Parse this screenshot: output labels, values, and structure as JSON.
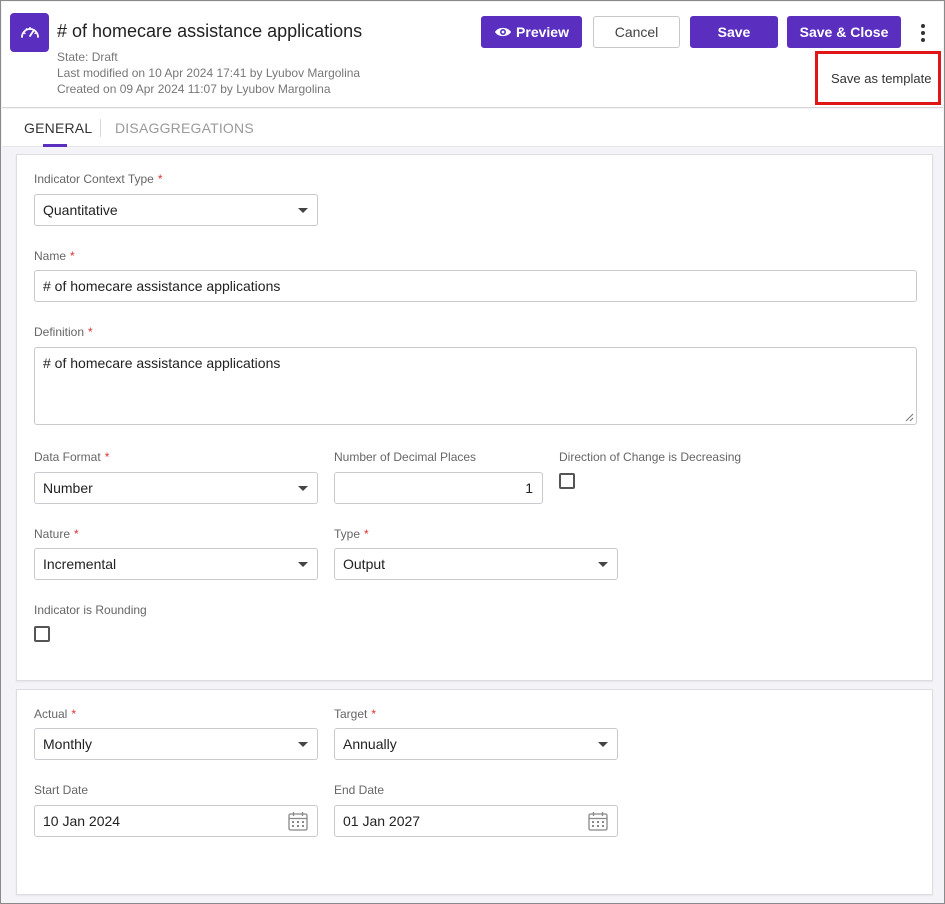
{
  "header": {
    "title": "# of homecare assistance applications",
    "state": "State: Draft",
    "last_modified": "Last modified on 10 Apr 2024 17:41 by Lyubov Margolina",
    "created": "Created on 09 Apr 2024 11:07 by Lyubov Margolina",
    "app_icon": "speedometer-icon",
    "buttons": {
      "preview": "Preview",
      "cancel": "Cancel",
      "save": "Save",
      "save_close": "Save & Close"
    },
    "save_as_template": "Save as template"
  },
  "tabs": [
    {
      "label": "GENERAL",
      "active": true
    },
    {
      "label": "DISAGGREGATIONS",
      "active": false
    }
  ],
  "general": {
    "indicator_context_type": {
      "label": "Indicator Context Type",
      "value": "Quantitative",
      "required": true
    },
    "name": {
      "label": "Name",
      "value": "# of homecare assistance applications",
      "required": true
    },
    "definition": {
      "label": "Definition",
      "value": "# of homecare assistance applications",
      "required": true
    },
    "data_format": {
      "label": "Data Format",
      "value": "Number",
      "required": true
    },
    "decimal_places": {
      "label": "Number of Decimal Places",
      "value": "1"
    },
    "direction_decreasing": {
      "label": "Direction of Change is Decreasing",
      "checked": false
    },
    "nature": {
      "label": "Nature",
      "value": "Incremental",
      "required": true
    },
    "type": {
      "label": "Type",
      "value": "Output",
      "required": true
    },
    "rounding": {
      "label": "Indicator is Rounding",
      "checked": false
    }
  },
  "schedule": {
    "actual": {
      "label": "Actual",
      "value": "Monthly",
      "required": true
    },
    "target": {
      "label": "Target",
      "value": "Annually",
      "required": true
    },
    "start_date": {
      "label": "Start Date",
      "value": "10 Jan 2024"
    },
    "end_date": {
      "label": "End Date",
      "value": "01 Jan 2027"
    }
  },
  "colors": {
    "primary": "#5a2fbf",
    "required": "#e03030",
    "highlight": "#e01515"
  }
}
